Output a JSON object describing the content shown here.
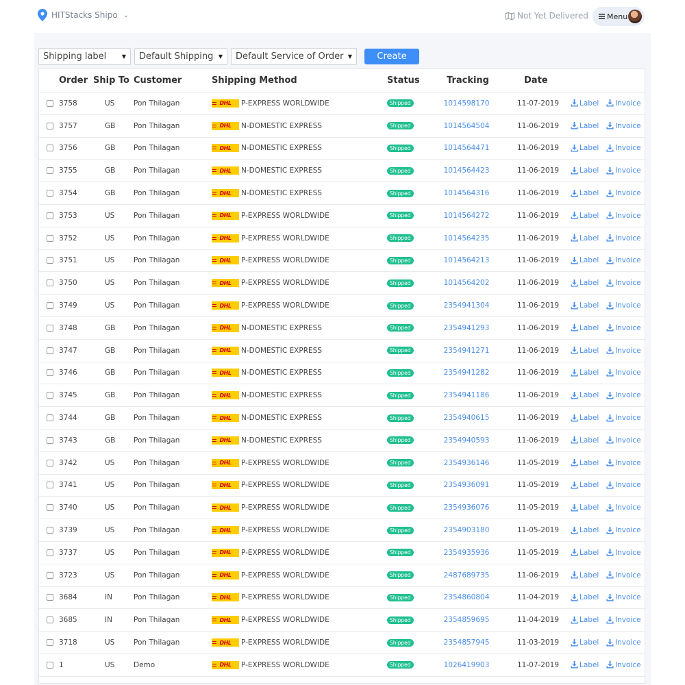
{
  "header": {
    "brand": "HITStacks Shipo",
    "not_delivered": "Not Yet Delivered",
    "menu_label": "Menu"
  },
  "controls": {
    "shipping_label": "Shipping label",
    "default_shipping": "Default Shipping",
    "default_service": "Default Service of Order",
    "create": "Create"
  },
  "table": {
    "headers": [
      "Order",
      "Ship To",
      "Customer",
      "Shipping Method",
      "Status",
      "Tracking",
      "Date"
    ],
    "label_text": "Label",
    "invoice_text": "Invoice",
    "rows": [
      {
        "order": "3758",
        "ship_to": "US",
        "customer": "Pon Thilagan",
        "method": "P-EXPRESS WORLDWIDE",
        "status": "Shipped",
        "tracking": "1014598170",
        "date": "11-07-2019"
      },
      {
        "order": "3757",
        "ship_to": "GB",
        "customer": "Pon Thilagan",
        "method": "N-DOMESTIC EXPRESS",
        "status": "Shipped",
        "tracking": "1014564504",
        "date": "11-06-2019"
      },
      {
        "order": "3756",
        "ship_to": "GB",
        "customer": "Pon Thilagan",
        "method": "N-DOMESTIC EXPRESS",
        "status": "Shipped",
        "tracking": "1014564471",
        "date": "11-06-2019"
      },
      {
        "order": "3755",
        "ship_to": "GB",
        "customer": "Pon Thilagan",
        "method": "N-DOMESTIC EXPRESS",
        "status": "Shipped",
        "tracking": "1014564423",
        "date": "11-06-2019"
      },
      {
        "order": "3754",
        "ship_to": "GB",
        "customer": "Pon Thilagan",
        "method": "N-DOMESTIC EXPRESS",
        "status": "Shipped",
        "tracking": "1014564316",
        "date": "11-06-2019"
      },
      {
        "order": "3753",
        "ship_to": "US",
        "customer": "Pon Thilagan",
        "method": "P-EXPRESS WORLDWIDE",
        "status": "Shipped",
        "tracking": "1014564272",
        "date": "11-06-2019"
      },
      {
        "order": "3752",
        "ship_to": "US",
        "customer": "Pon Thilagan",
        "method": "P-EXPRESS WORLDWIDE",
        "status": "Shipped",
        "tracking": "1014564235",
        "date": "11-06-2019"
      },
      {
        "order": "3751",
        "ship_to": "US",
        "customer": "Pon Thilagan",
        "method": "P-EXPRESS WORLDWIDE",
        "status": "Shipped",
        "tracking": "1014564213",
        "date": "11-06-2019"
      },
      {
        "order": "3750",
        "ship_to": "US",
        "customer": "Pon Thilagan",
        "method": "P-EXPRESS WORLDWIDE",
        "status": "Shipped",
        "tracking": "1014564202",
        "date": "11-06-2019"
      },
      {
        "order": "3749",
        "ship_to": "US",
        "customer": "Pon Thilagan",
        "method": "P-EXPRESS WORLDWIDE",
        "status": "Shipped",
        "tracking": "2354941304",
        "date": "11-06-2019"
      },
      {
        "order": "3748",
        "ship_to": "GB",
        "customer": "Pon Thilagan",
        "method": "N-DOMESTIC EXPRESS",
        "status": "Shipped",
        "tracking": "2354941293",
        "date": "11-06-2019"
      },
      {
        "order": "3747",
        "ship_to": "GB",
        "customer": "Pon Thilagan",
        "method": "N-DOMESTIC EXPRESS",
        "status": "Shipped",
        "tracking": "2354941271",
        "date": "11-06-2019"
      },
      {
        "order": "3746",
        "ship_to": "GB",
        "customer": "Pon Thilagan",
        "method": "N-DOMESTIC EXPRESS",
        "status": "Shipped",
        "tracking": "2354941282",
        "date": "11-06-2019"
      },
      {
        "order": "3745",
        "ship_to": "GB",
        "customer": "Pon Thilagan",
        "method": "N-DOMESTIC EXPRESS",
        "status": "Shipped",
        "tracking": "2354941186",
        "date": "11-06-2019"
      },
      {
        "order": "3744",
        "ship_to": "GB",
        "customer": "Pon Thilagan",
        "method": "N-DOMESTIC EXPRESS",
        "status": "Shipped",
        "tracking": "2354940615",
        "date": "11-06-2019"
      },
      {
        "order": "3743",
        "ship_to": "GB",
        "customer": "Pon Thilagan",
        "method": "N-DOMESTIC EXPRESS",
        "status": "Shipped",
        "tracking": "2354940593",
        "date": "11-06-2019"
      },
      {
        "order": "3742",
        "ship_to": "US",
        "customer": "Pon Thilagan",
        "method": "P-EXPRESS WORLDWIDE",
        "status": "Shipped",
        "tracking": "2354936146",
        "date": "11-05-2019"
      },
      {
        "order": "3741",
        "ship_to": "US",
        "customer": "Pon Thilagan",
        "method": "P-EXPRESS WORLDWIDE",
        "status": "Shipped",
        "tracking": "2354936091",
        "date": "11-05-2019"
      },
      {
        "order": "3740",
        "ship_to": "US",
        "customer": "Pon Thilagan",
        "method": "P-EXPRESS WORLDWIDE",
        "status": "Shipped",
        "tracking": "2354936076",
        "date": "11-05-2019"
      },
      {
        "order": "3739",
        "ship_to": "US",
        "customer": "Pon Thilagan",
        "method": "P-EXPRESS WORLDWIDE",
        "status": "Shipped",
        "tracking": "2354903180",
        "date": "11-05-2019"
      },
      {
        "order": "3737",
        "ship_to": "US",
        "customer": "Pon Thilagan",
        "method": "P-EXPRESS WORLDWIDE",
        "status": "Shipped",
        "tracking": "2354935936",
        "date": "11-05-2019"
      },
      {
        "order": "3723",
        "ship_to": "US",
        "customer": "Pon Thilagan",
        "method": "P-EXPRESS WORLDWIDE",
        "status": "Shipped",
        "tracking": "2487689735",
        "date": "11-06-2019"
      },
      {
        "order": "3684",
        "ship_to": "IN",
        "customer": "Pon Thilagan",
        "method": "P-EXPRESS WORLDWIDE",
        "status": "Shipped",
        "tracking": "2354860804",
        "date": "11-04-2019"
      },
      {
        "order": "3685",
        "ship_to": "IN",
        "customer": "Pon Thilagan",
        "method": "P-EXPRESS WORLDWIDE",
        "status": "Shipped",
        "tracking": "2354859695",
        "date": "11-04-2019"
      },
      {
        "order": "3718",
        "ship_to": "US",
        "customer": "Pon Thilagan",
        "method": "P-EXPRESS WORLDWIDE",
        "status": "Shipped",
        "tracking": "2354857945",
        "date": "11-03-2019"
      },
      {
        "order": "1",
        "ship_to": "US",
        "customer": "Demo",
        "method": "P-EXPRESS WORLDWIDE",
        "status": "Shipped",
        "tracking": "1026419903",
        "date": "11-07-2019"
      }
    ]
  },
  "icons": {
    "brand": "map-pin-icon",
    "not_delivered": "map-icon",
    "menu": "hamburger-icon",
    "download": "download-icon",
    "carrier": "dhl-logo"
  },
  "colors": {
    "primary": "#3e8ef7",
    "link": "#4a8ee8",
    "status_shipped": "#1fbf8f",
    "dhl_yellow": "#ffcc00",
    "dhl_red": "#d40511"
  }
}
